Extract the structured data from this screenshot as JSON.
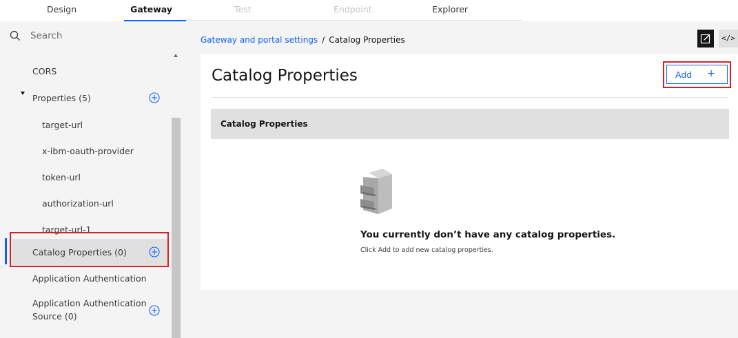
{
  "tabs": [
    {
      "label": "Design"
    },
    {
      "label": "Gateway"
    },
    {
      "label": "Test"
    },
    {
      "label": "Endpoint"
    },
    {
      "label": "Explorer"
    }
  ],
  "sidebar": {
    "search_placeholder": "Search",
    "items": [
      {
        "label": "CORS"
      },
      {
        "label": "Properties (5)"
      },
      {
        "label": "target-url"
      },
      {
        "label": "x-ibm-oauth-provider"
      },
      {
        "label": "token-url"
      },
      {
        "label": "authorization-url"
      },
      {
        "label": "target-url-1"
      },
      {
        "label": "Catalog Properties (0)"
      },
      {
        "label": "Application Authentication"
      },
      {
        "label": "Application Authentication"
      },
      {
        "label": "Source (0)"
      }
    ]
  },
  "breadcrumb": {
    "link": "Gateway and portal settings",
    "separator": "/",
    "current": "Catalog Properties"
  },
  "toolbar": {
    "code_label": "</>"
  },
  "card": {
    "title": "Catalog Properties",
    "add_label": "Add",
    "add_plus": "+",
    "table_header": "Catalog Properties",
    "empty_title": "You currently don’t have any catalog properties.",
    "empty_subtitle": "Click Add to add new catalog properties."
  },
  "colors": {
    "accent": "#0f62fe",
    "highlight": "#da1e28"
  }
}
